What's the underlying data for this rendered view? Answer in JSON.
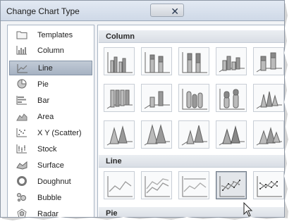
{
  "window": {
    "title": "Change Chart Type",
    "close_icon": "close-icon"
  },
  "sidebar": {
    "items": [
      {
        "label": "Templates",
        "icon": "folder-icon"
      },
      {
        "label": "Column",
        "icon": "column-chart-icon"
      },
      {
        "label": "Line",
        "icon": "line-chart-icon",
        "selected": true
      },
      {
        "label": "Pie",
        "icon": "pie-chart-icon"
      },
      {
        "label": "Bar",
        "icon": "bar-chart-icon"
      },
      {
        "label": "Area",
        "icon": "area-chart-icon"
      },
      {
        "label": "X Y (Scatter)",
        "icon": "scatter-chart-icon"
      },
      {
        "label": "Stock",
        "icon": "stock-chart-icon"
      },
      {
        "label": "Surface",
        "icon": "surface-chart-icon"
      },
      {
        "label": "Doughnut",
        "icon": "doughnut-chart-icon"
      },
      {
        "label": "Bubble",
        "icon": "bubble-chart-icon"
      },
      {
        "label": "Radar",
        "icon": "radar-chart-icon"
      }
    ]
  },
  "gallery": {
    "sections": [
      {
        "title": "Column"
      },
      {
        "title": "Line"
      },
      {
        "title": "Pie"
      }
    ]
  },
  "colors": {
    "accent_selected": "#a6b2c2",
    "bar_fill": "#a9a9a9",
    "line_stroke": "#9a9a9a"
  }
}
